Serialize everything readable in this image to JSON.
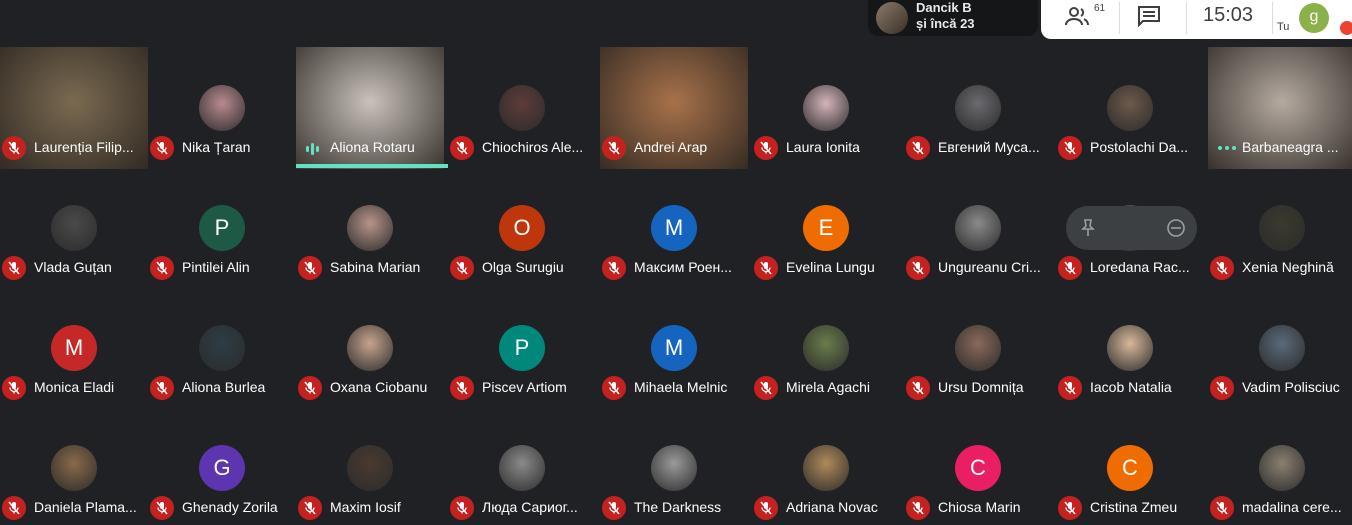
{
  "presenter": {
    "name": "Dancik B",
    "more": "și încă 23"
  },
  "top_right": {
    "participants_count": "61",
    "time": "15:03",
    "self_initial": "g",
    "self_label": "Tu"
  },
  "tiles": [
    {
      "name": "Laurenția Filip...",
      "type": "video",
      "mic": "off",
      "bg": "#7a6a50"
    },
    {
      "name": "Nika Țaran",
      "type": "photo",
      "mic": "off",
      "bg": "#b98a8f"
    },
    {
      "name": "Aliona Rotaru",
      "type": "video",
      "mic": "speaking",
      "bg": "#c9c2bb"
    },
    {
      "name": "Chiochiros Ale...",
      "type": "photo",
      "mic": "off",
      "bg": "#5e3c3a"
    },
    {
      "name": "Andrei Arap",
      "type": "video",
      "mic": "off",
      "bg": "#a8724a"
    },
    {
      "name": "Laura Ionita",
      "type": "photo",
      "mic": "off",
      "bg": "#d5b4bb"
    },
    {
      "name": "Евгений Муса...",
      "type": "photo",
      "mic": "off",
      "bg": "#6b6b70"
    },
    {
      "name": "Postolachi Da...",
      "type": "photo",
      "mic": "off",
      "bg": "#6d5a4a"
    },
    {
      "name": "Barbaneagra ...",
      "type": "video",
      "mic": "dots",
      "bg": "#b4aaa0"
    },
    {
      "name": "Vlada Guțan",
      "type": "photo",
      "mic": "off",
      "bg": "#4a4a4a"
    },
    {
      "name": "Pintilei Alin",
      "type": "letter",
      "letter": "P",
      "mic": "off",
      "bg": "#1e5945"
    },
    {
      "name": "Sabina Marian",
      "type": "photo",
      "mic": "off",
      "bg": "#b8948a"
    },
    {
      "name": "Olga Surugiu",
      "type": "letter",
      "letter": "O",
      "mic": "off",
      "bg": "#bf360c"
    },
    {
      "name": "Максим Роен...",
      "type": "letter",
      "letter": "M",
      "mic": "off",
      "bg": "#1565c0"
    },
    {
      "name": "Evelina Lungu",
      "type": "letter",
      "letter": "E",
      "mic": "off",
      "bg": "#ef6c00"
    },
    {
      "name": "Ungureanu Cri...",
      "type": "photo",
      "mic": "off",
      "bg": "#8a8a8a"
    },
    {
      "name": "Loredana Rac...",
      "type": "photo",
      "mic": "off",
      "bg": "#7a6a6a"
    },
    {
      "name": "Xenia Neghină",
      "type": "photo",
      "mic": "off",
      "bg": "#3a3a2e"
    },
    {
      "name": "Monica Eladi",
      "type": "letter",
      "letter": "M",
      "mic": "off",
      "bg": "#c62828"
    },
    {
      "name": "Aliona Burlea",
      "type": "photo",
      "mic": "off",
      "bg": "#2c3e45"
    },
    {
      "name": "Oxana Ciobanu",
      "type": "photo",
      "mic": "off",
      "bg": "#c7a48e"
    },
    {
      "name": "Piscev Artiom",
      "type": "letter",
      "letter": "P",
      "mic": "off",
      "bg": "#00897b"
    },
    {
      "name": "Mihaela Melnic",
      "type": "letter",
      "letter": "M",
      "mic": "off",
      "bg": "#1565c0"
    },
    {
      "name": "Mirela Agachi",
      "type": "photo",
      "mic": "off",
      "bg": "#6a7d4a"
    },
    {
      "name": "Ursu Domnița",
      "type": "photo",
      "mic": "off",
      "bg": "#8a6a5a"
    },
    {
      "name": "Iacob Natalia",
      "type": "photo",
      "mic": "off",
      "bg": "#d8b89a"
    },
    {
      "name": "Vadim Polisciuc",
      "type": "photo",
      "mic": "off",
      "bg": "#5a6a7a"
    },
    {
      "name": "Daniela Plama...",
      "type": "photo",
      "mic": "off",
      "bg": "#8a6a4a"
    },
    {
      "name": "Ghenady Zorila",
      "type": "letter",
      "letter": "G",
      "mic": "off",
      "bg": "#5e35b1"
    },
    {
      "name": "Maxim Iosif",
      "type": "photo",
      "mic": "off",
      "bg": "#4a3a30"
    },
    {
      "name": "Люда Сариог...",
      "type": "photo",
      "mic": "off",
      "bg": "#8a8a8a"
    },
    {
      "name": "The Darkness",
      "type": "photo",
      "mic": "off",
      "bg": "#9a9a9a"
    },
    {
      "name": "Adriana Novac",
      "type": "photo",
      "mic": "off",
      "bg": "#b08a5a"
    },
    {
      "name": "Chiosa Marin",
      "type": "letter",
      "letter": "C",
      "mic": "off",
      "bg": "#e91e63"
    },
    {
      "name": "Cristina Zmeu",
      "type": "letter",
      "letter": "C",
      "mic": "off",
      "bg": "#ef6c00"
    },
    {
      "name": "madalina cere...",
      "type": "photo",
      "mic": "off",
      "bg": "#8a8070"
    }
  ]
}
